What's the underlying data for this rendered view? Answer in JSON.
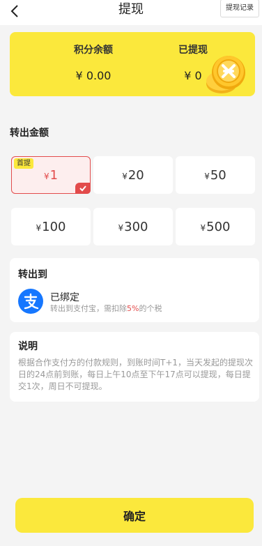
{
  "header": {
    "title": "提现",
    "history_label": "提现记录",
    "back_icon": "chevron-left-icon"
  },
  "balance": {
    "points_label": "积分余额",
    "points_value": "¥ 0.00",
    "withdrawn_label": "已提现",
    "withdrawn_value": "¥ 0",
    "coin_icon": "gold-coin-icon",
    "card_color": "#fbe83c"
  },
  "transfer_amount": {
    "title": "转出金额",
    "first_tag": "首提",
    "currency": "¥",
    "options": [
      "1",
      "20",
      "50",
      "100",
      "300",
      "500"
    ],
    "selected_index": 0,
    "selected_color": "#e24b4b"
  },
  "transfer_to": {
    "title": "转出到",
    "account_status": "已绑定",
    "desc_prefix": "转出到支付宝，需扣除",
    "desc_percent": "5%",
    "desc_suffix": "的个税",
    "icon": "alipay-icon",
    "icon_color": "#1677ff"
  },
  "explanation": {
    "title": "说明",
    "text": "根据合作支付方的付款规则，到账时间T+1，当天发起的提现次日的24点前到账，每日上午10点至下午17点可以提现，每日提交1次，周日不可提现。"
  },
  "confirm_label": "确定"
}
